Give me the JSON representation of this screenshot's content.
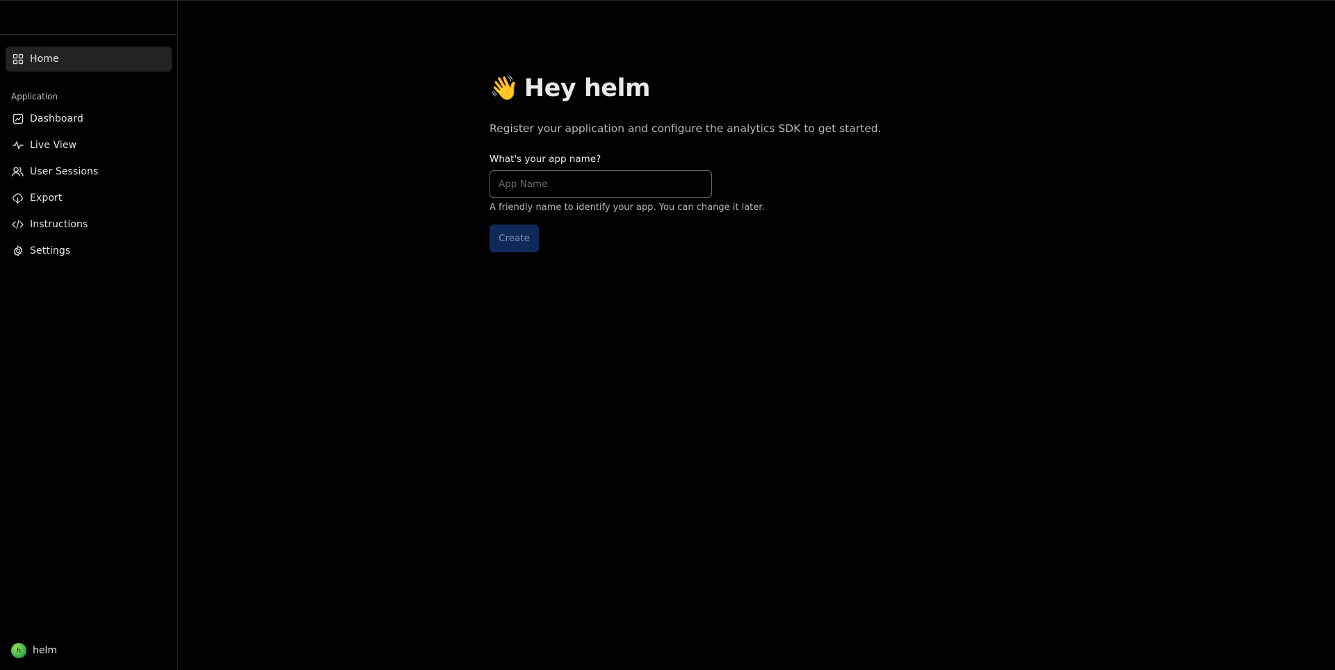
{
  "sidebar": {
    "home_label": "Home",
    "section_label": "Application",
    "items": [
      {
        "label": "Dashboard",
        "icon": "chart-icon"
      },
      {
        "label": "Live View",
        "icon": "activity-icon"
      },
      {
        "label": "User Sessions",
        "icon": "users-icon"
      },
      {
        "label": "Export",
        "icon": "cloud-download-icon"
      },
      {
        "label": "Instructions",
        "icon": "code-icon"
      },
      {
        "label": "Settings",
        "icon": "gear-icon"
      }
    ],
    "user": {
      "avatar_initial": "h",
      "name": "helm"
    }
  },
  "main": {
    "wave_emoji": "👋",
    "title": "Hey helm",
    "subtitle": "Register your application and configure the analytics SDK to get started.",
    "field_label": "What's your app name?",
    "input_placeholder": "App Name",
    "input_value": "",
    "hint": "A friendly name to identify your app. You can change it later.",
    "create_label": "Create"
  },
  "colors": {
    "background": "#000000",
    "sidebar_active": "#232323",
    "create_button_bg": "#0f2a5a",
    "create_button_text": "#7f90b3",
    "avatar": "#37b24d"
  }
}
